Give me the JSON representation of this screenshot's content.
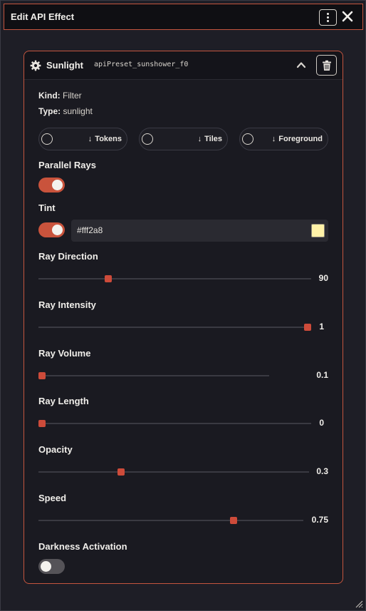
{
  "window": {
    "title": "Edit API Effect"
  },
  "effect": {
    "name": "Sunlight",
    "preset_id": "apiPreset_sunshower_f0",
    "kind_label": "Kind:",
    "kind_value": "Filter",
    "type_label": "Type:",
    "type_value": "sunlight"
  },
  "targets": [
    {
      "label": "Tokens",
      "selected": false
    },
    {
      "label": "Tiles",
      "selected": false
    },
    {
      "label": "Foreground",
      "selected": false
    }
  ],
  "parallel_rays": {
    "label": "Parallel Rays",
    "on": true
  },
  "tint": {
    "label": "Tint",
    "on": true,
    "hex": "#fff2a8",
    "color": "#fff2a8"
  },
  "sliders": [
    {
      "label": "Ray Direction",
      "value": "90",
      "fraction": 0.25
    },
    {
      "label": "Ray Intensity",
      "value": "1",
      "fraction": 1.0
    },
    {
      "label": "Ray Volume",
      "value": "0.1",
      "fraction": 0.0
    },
    {
      "label": "Ray Length",
      "value": "0",
      "fraction": 0.0
    },
    {
      "label": "Opacity",
      "value": "0.3",
      "fraction": 0.3
    },
    {
      "label": "Speed",
      "value": "0.75",
      "fraction": 0.744
    }
  ],
  "darkness_activation": {
    "label": "Darkness Activation",
    "on": false
  },
  "colors": {
    "accent": "#c9533c",
    "border": "#c4553e",
    "background": "#1e1e26"
  }
}
